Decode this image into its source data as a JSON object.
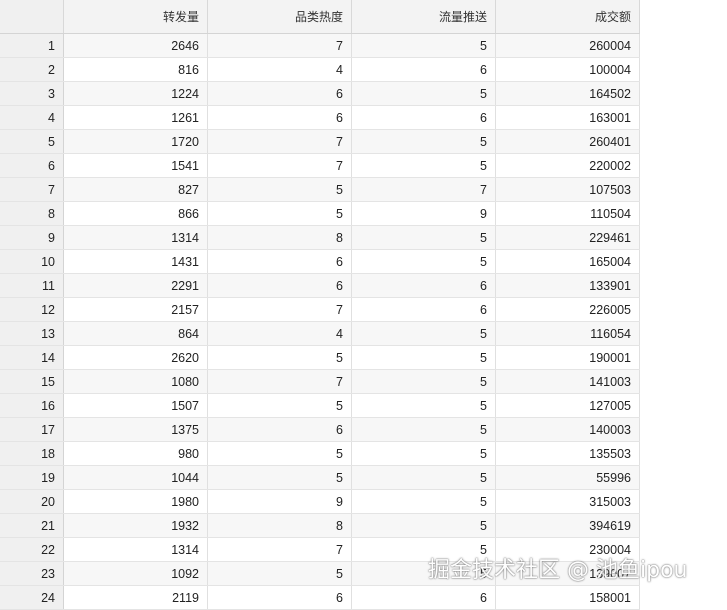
{
  "table": {
    "columns": [
      "",
      "转发量",
      "品类热度",
      "流量推送",
      "成交额"
    ],
    "rows": [
      [
        "1",
        "2646",
        "7",
        "5",
        "260004"
      ],
      [
        "2",
        "816",
        "4",
        "6",
        "100004"
      ],
      [
        "3",
        "1224",
        "6",
        "5",
        "164502"
      ],
      [
        "4",
        "1261",
        "6",
        "6",
        "163001"
      ],
      [
        "5",
        "1720",
        "7",
        "5",
        "260401"
      ],
      [
        "6",
        "1541",
        "7",
        "5",
        "220002"
      ],
      [
        "7",
        "827",
        "5",
        "7",
        "107503"
      ],
      [
        "8",
        "866",
        "5",
        "9",
        "110504"
      ],
      [
        "9",
        "1314",
        "8",
        "5",
        "229461"
      ],
      [
        "10",
        "1431",
        "6",
        "5",
        "165004"
      ],
      [
        "11",
        "2291",
        "6",
        "6",
        "133901"
      ],
      [
        "12",
        "2157",
        "7",
        "6",
        "226005"
      ],
      [
        "13",
        "864",
        "4",
        "5",
        "116054"
      ],
      [
        "14",
        "2620",
        "5",
        "5",
        "190001"
      ],
      [
        "15",
        "1080",
        "7",
        "5",
        "141003"
      ],
      [
        "16",
        "1507",
        "5",
        "5",
        "127005"
      ],
      [
        "17",
        "1375",
        "6",
        "5",
        "140003"
      ],
      [
        "18",
        "980",
        "5",
        "5",
        "135503"
      ],
      [
        "19",
        "1044",
        "5",
        "5",
        "55996"
      ],
      [
        "20",
        "1980",
        "9",
        "5",
        "315003"
      ],
      [
        "21",
        "1932",
        "8",
        "5",
        "394619"
      ],
      [
        "22",
        "1314",
        "7",
        "5",
        "230004"
      ],
      [
        "23",
        "1092",
        "5",
        "5",
        "139007"
      ],
      [
        "24",
        "2119",
        "6",
        "6",
        "158001"
      ]
    ]
  },
  "watermark": "掘金技术社区 @ 池鱼ipou"
}
